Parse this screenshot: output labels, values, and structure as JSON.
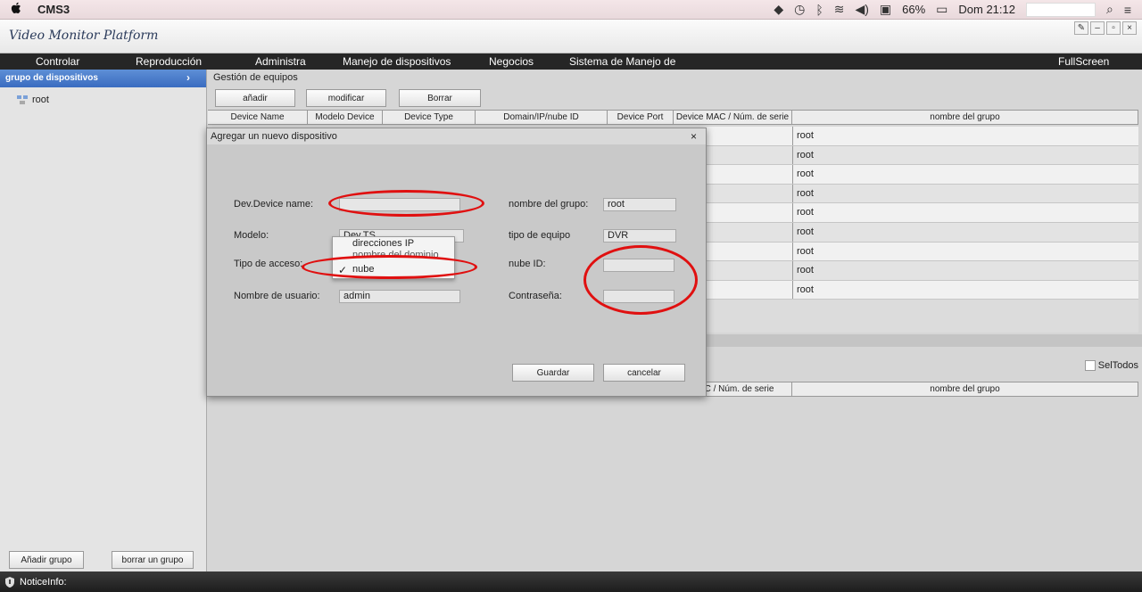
{
  "menubar": {
    "app_name": "CMS3",
    "battery": "66%",
    "clock": "Dom 21:12"
  },
  "window": {
    "title": "Video Monitor Platform"
  },
  "nav": {
    "items": [
      "Controlar",
      "Reproducción",
      "Administra",
      "Manejo de dispositivos",
      "Negocios",
      "Sistema de Manejo de"
    ],
    "fullscreen": "FullScreen"
  },
  "sidebar": {
    "header": "grupo de dispositivos",
    "tree_root": "root",
    "add_group": "Añadir grupo",
    "delete_group": "borrar un grupo"
  },
  "main": {
    "section_title": "Gestión de equipos",
    "toolbar": {
      "add": "añadir",
      "modify": "modificar",
      "delete": "Borrar"
    },
    "columns": [
      "Device Name",
      "Modelo Device",
      "Device Type",
      "Domain/IP/nube ID",
      "Device Port",
      "Device MAC / Núm. de serie",
      "nombre del grupo"
    ],
    "rows": [
      "root",
      "root",
      "root",
      "root",
      "root",
      "root",
      "root",
      "root",
      "root"
    ],
    "seltodos": "SelTodos",
    "lower_columns": [
      "MAC / Núm. de serie",
      "nombre del grupo"
    ]
  },
  "dialog": {
    "title": "Agregar un nuevo dispositivo",
    "close": "×",
    "labels": {
      "device_name": "Dev.Device name:",
      "group_name": "nombre del grupo:",
      "model": "Modelo:",
      "device_type": "tipo de equipo",
      "access_type": "Tipo de acceso:",
      "nube_id": "nube ID:",
      "username": "Nombre de usuario:",
      "password": "Contraseña:"
    },
    "values": {
      "device_name": "",
      "group_name": "root",
      "model": "Dev.TS",
      "device_type": "DVR",
      "nube_id": "",
      "username": "admin",
      "password": ""
    },
    "access_options": [
      "direcciones IP",
      "nombre del dominio",
      "nube"
    ],
    "access_selected": "nube",
    "save": "Guardar",
    "cancel": "cancelar"
  },
  "notice": {
    "label": "NoticeInfo:"
  },
  "colors": {
    "annotation": "#e01010",
    "sidebar_header": "#3a6cc0",
    "nav_bg": "#262626"
  }
}
